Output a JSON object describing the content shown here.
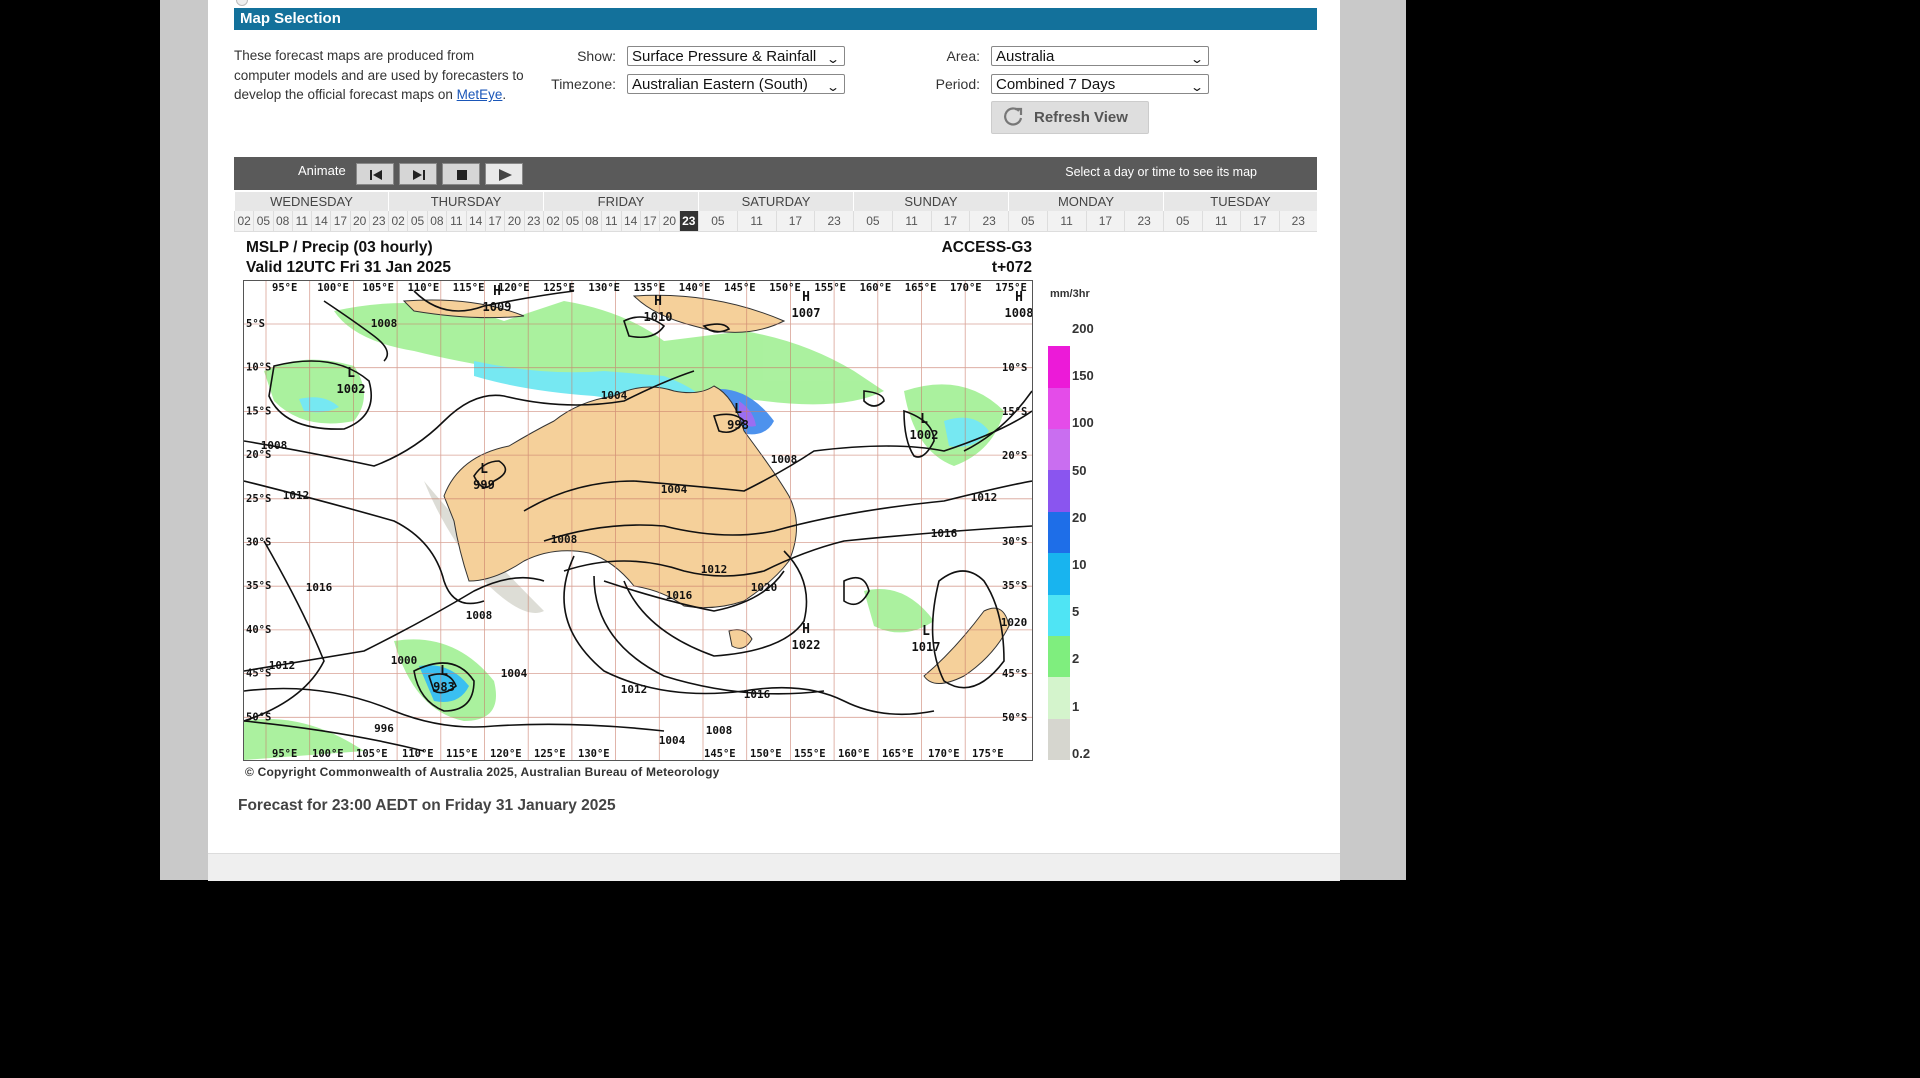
{
  "section": {
    "title": "Map Selection"
  },
  "intro": {
    "text_before_link": "These forecast maps are produced from computer models and are used by forecasters to develop the official forecast maps on ",
    "link_text": "MetEye",
    "text_after_link": "."
  },
  "form": {
    "show_label": "Show:",
    "show_value": "Surface Pressure & Rainfall",
    "timezone_label": "Timezone:",
    "timezone_value": "Australian Eastern (South)",
    "area_label": "Area:",
    "area_value": "Australia",
    "period_label": "Period:",
    "period_value": "Combined 7 Days",
    "refresh_label": "Refresh View"
  },
  "animate": {
    "label": "Animate",
    "hint": "Select a day or time to see its map"
  },
  "days": [
    "WEDNESDAY",
    "THURSDAY",
    "FRIDAY",
    "SATURDAY",
    "SUNDAY",
    "MONDAY",
    "TUESDAY"
  ],
  "hours": {
    "wednesday": [
      "02",
      "05",
      "08",
      "11",
      "14",
      "17",
      "20",
      "23"
    ],
    "thursday": [
      "02",
      "05",
      "08",
      "11",
      "14",
      "17",
      "20",
      "23"
    ],
    "friday": [
      "02",
      "05",
      "08",
      "11",
      "14",
      "17",
      "20",
      "23"
    ],
    "saturday": [
      "05",
      "11",
      "17",
      "23"
    ],
    "sunday": [
      "05",
      "11",
      "17",
      "23"
    ],
    "monday": [
      "05",
      "11",
      "17",
      "23"
    ],
    "tuesday": [
      "05",
      "11",
      "17",
      "23"
    ],
    "selected": "friday-23"
  },
  "map": {
    "title_left_1": "MSLP / Precip  (03 hourly)",
    "title_left_2": "Valid 12UTC Fri 31 Jan 2025",
    "title_right_1": "ACCESS-G3",
    "title_right_2": "t+072",
    "lon_labels_top": [
      "95°E",
      "100°E",
      "105°E",
      "110°E",
      "115°E",
      "120°E",
      "125°E",
      "130°E",
      "135°E",
      "140°E",
      "145°E",
      "150°E",
      "155°E",
      "160°E",
      "165°E",
      "170°E",
      "175°E"
    ],
    "lon_labels_bottom": [
      "95°E",
      "100°E",
      "105°E",
      "110°E",
      "115°E",
      "120°E",
      "125°E",
      "130°E",
      "145°E",
      "150°E",
      "155°E",
      "160°E",
      "165°E",
      "170°E",
      "175°E"
    ],
    "lat_labels_left": [
      "5°S",
      "10°S",
      "15°S",
      "20°S",
      "25°S",
      "30°S",
      "35°S",
      "40°S",
      "45°S",
      "50°S"
    ],
    "lat_labels_right": [
      "10°S",
      "15°S",
      "20°S",
      "30°S",
      "35°S",
      "45°S",
      "50°S"
    ],
    "pressure_centres": [
      {
        "type": "H",
        "value": "1009"
      },
      {
        "type": "H",
        "value": "1010"
      },
      {
        "type": "H",
        "value": "1007"
      },
      {
        "type": "H",
        "value": "1008"
      },
      {
        "type": "L",
        "value": "1002"
      },
      {
        "type": "L",
        "value": "998"
      },
      {
        "type": "L",
        "value": "1002"
      },
      {
        "type": "L",
        "value": "999"
      },
      {
        "type": "L",
        "value": "983"
      },
      {
        "type": "H",
        "value": "1022"
      },
      {
        "type": "L",
        "value": "1017"
      }
    ],
    "isobar_labels": [
      "1008",
      "1004",
      "1008",
      "1012",
      "1004",
      "1008",
      "1012",
      "1016",
      "1020",
      "1016",
      "1008",
      "1004",
      "1012",
      "1000",
      "1016",
      "1012",
      "1008",
      "1004",
      "996",
      "1012",
      "1016",
      "1020",
      "1008"
    ],
    "copyright": "© Copyright Commonwealth of Australia 2025, Australian Bureau of Meteorology"
  },
  "legend": {
    "unit": "mm/3hr",
    "labels": [
      "200",
      "150",
      "100",
      "50",
      "20",
      "10",
      "5",
      "2",
      "1",
      "0.2"
    ],
    "colors": [
      "#ffffff",
      "#ec1ad8",
      "#e44ce9",
      "#c96ef0",
      "#8a55ef",
      "#1e6ee8",
      "#18b4ef",
      "#4fe4f4",
      "#7fee7e",
      "#d4f4cc",
      "#d6d6cf"
    ]
  },
  "forecast_caption": "Forecast for 23:00 AEDT on Friday 31 January 2025"
}
